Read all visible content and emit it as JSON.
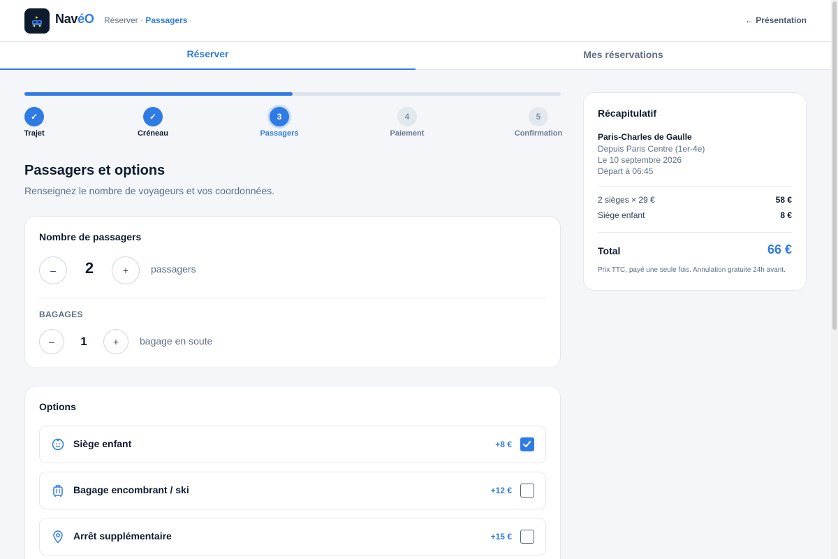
{
  "brand": {
    "name_main": "Nav",
    "name_accent": "éO"
  },
  "breadcrumb": {
    "root": "Réserver",
    "sep": " · ",
    "current": "Passagers"
  },
  "header": {
    "back_label": "← Présentation"
  },
  "tabs": [
    {
      "label": "Réserver",
      "active": true
    },
    {
      "label": "Mes réservations",
      "active": false
    }
  ],
  "progress": {
    "fraction": 0.5
  },
  "steps": [
    {
      "label": "Trajet",
      "state": "done",
      "mark": "✓"
    },
    {
      "label": "Créneau",
      "state": "done",
      "mark": "✓"
    },
    {
      "label": "Passagers",
      "state": "current",
      "mark": "3"
    },
    {
      "label": "Paiement",
      "state": "todo",
      "mark": "4"
    },
    {
      "label": "Confirmation",
      "state": "todo",
      "mark": "5"
    }
  ],
  "page": {
    "title": "Passagers et options",
    "subtitle": "Renseignez le nombre de voyageurs et vos coordonnées."
  },
  "passengers": {
    "title": "Nombre de passagers",
    "minus": "–",
    "plus": "+",
    "value": "2",
    "unit": "passagers",
    "luggage_section": "BAGAGES",
    "luggage_value": "1",
    "luggage_unit": "bagage en soute"
  },
  "options": {
    "title": "Options",
    "items": [
      {
        "icon": "baby-face-icon",
        "label": "Siège enfant",
        "price": "+8 €",
        "checked": true
      },
      {
        "icon": "luggage-icon",
        "label": "Bagage encombrant / ski",
        "price": "+12 €",
        "checked": false
      },
      {
        "icon": "location-pin-icon",
        "label": "Arrêt supplémentaire",
        "price": "+15 €",
        "checked": false
      }
    ]
  },
  "summary": {
    "title": "Récapitulatif",
    "destination": "Paris-Charles de Gaulle",
    "from": "Depuis Paris Centre (1er-4e)",
    "date": "Le 10 septembre 2026",
    "departure": "Départ à 06:45",
    "lines": [
      {
        "label": "2 sièges × 29 €",
        "amount": "58 €"
      },
      {
        "label": "Siège enfant",
        "amount": "8 €"
      }
    ],
    "total_label": "Total",
    "total_amount": "66 €",
    "note": "Prix TTC, payé une seule fois. Annulation gratuite 24h avant."
  },
  "colors": {
    "accent": "#2e7be6",
    "navy": "#0d1b2e",
    "logo_yellow": "#f5c542"
  }
}
